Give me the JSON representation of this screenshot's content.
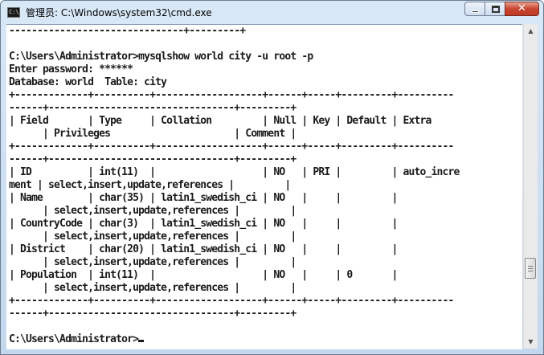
{
  "window": {
    "title": "管理员: C:\\Windows\\system32\\cmd.exe",
    "icon": "console-icon",
    "icon_text": "C:\\",
    "buttons": {
      "minimize": "minimize-icon",
      "maximize": "maximize-icon",
      "close": "close-icon",
      "close_glyph": "✕"
    }
  },
  "console": {
    "text": "-------------------------------+---------+\n\nC:\\Users\\Administrator>mysqlshow world city -u root -p\nEnter password: ******\nDatabase: world  Table: city\n+-------------+----------+-------------------+------+-----+---------+----------\n------+---------------------------------+---------+\n| Field       | Type     | Collation         | Null | Key | Default | Extra\n      | Privileges                      | Comment |\n+-------------+----------+-------------------+------+-----+---------+----------\n------+---------------------------------+---------+\n| ID          | int(11)  |                   | NO   | PRI |         | auto_incre\nment | select,insert,update,references |         |\n| Name        | char(35) | latin1_swedish_ci | NO   |     |         |\n      | select,insert,update,references |         |\n| CountryCode | char(3)  | latin1_swedish_ci | NO   |     |         |\n      | select,insert,update,references |         |\n| District    | char(20) | latin1_swedish_ci | NO   |     |         |\n      | select,insert,update,references |         |\n| Population  | int(11)  |                   | NO   |     | 0       |\n      | select,insert,update,references |         |\n+-------------+----------+-------------------+------+-----+---------+----------\n------+---------------------------------+---------+\n\nC:\\Users\\Administrator>",
    "cursor": "_"
  },
  "scrollbar": {
    "up_arrow": "▲",
    "down_arrow": "▼"
  }
}
